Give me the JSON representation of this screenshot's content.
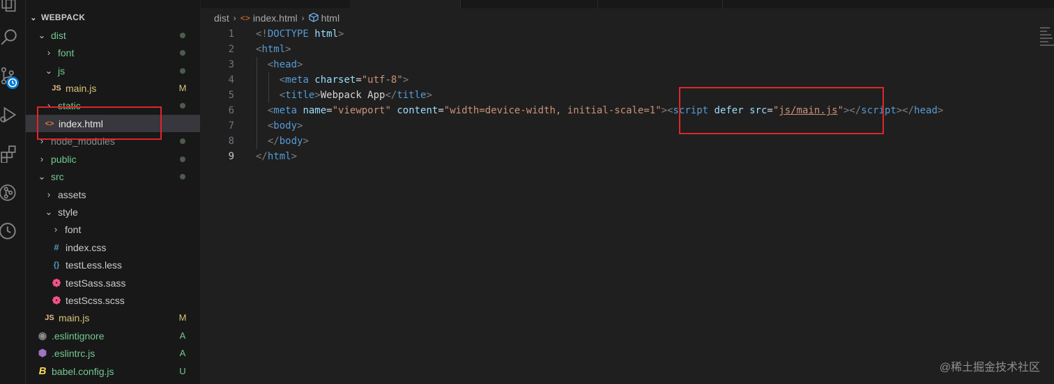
{
  "activity_bar": {
    "icons": [
      "explorer-icon",
      "search-icon",
      "source-control-icon",
      "run-debug-icon",
      "extensions-icon",
      "git-graph-icon",
      "timeline-icon"
    ]
  },
  "explorer": {
    "section_title": "WEBPACK",
    "items": [
      {
        "label": "dist",
        "status": "dot"
      },
      {
        "label": "font",
        "status": "dot"
      },
      {
        "label": "js",
        "status": "dot"
      },
      {
        "label": "main.js",
        "file_icon": "JS",
        "status": "M"
      },
      {
        "label": "static",
        "status": "dot"
      },
      {
        "label": "index.html",
        "file_icon": "<>",
        "status": ""
      },
      {
        "label": "node_modules",
        "status": "dot"
      },
      {
        "label": "public",
        "status": "dot"
      },
      {
        "label": "src",
        "status": "dot"
      },
      {
        "label": "assets",
        "status": ""
      },
      {
        "label": "style",
        "status": ""
      },
      {
        "label": "font",
        "status": ""
      },
      {
        "label": "index.css",
        "file_icon": "#",
        "status": ""
      },
      {
        "label": "testLess.less",
        "file_icon": "{}",
        "status": ""
      },
      {
        "label": "testSass.sass",
        "file_icon": "sass",
        "status": ""
      },
      {
        "label": "testScss.scss",
        "file_icon": "sass",
        "status": ""
      },
      {
        "label": "main.js",
        "file_icon": "JS",
        "status": "M"
      },
      {
        "label": ".eslintignore",
        "file_icon": "eslint",
        "status": "A"
      },
      {
        "label": ".eslintrc.js",
        "file_icon": "eslint",
        "status": "A"
      },
      {
        "label": "babel.config.js",
        "file_icon": "babel",
        "status": "U"
      }
    ]
  },
  "breadcrumb": {
    "folder": "dist",
    "file": "index.html",
    "symbol": "html"
  },
  "editor": {
    "line_numbers": [
      "1",
      "2",
      "3",
      "4",
      "5",
      "6",
      "7",
      "8",
      "9"
    ],
    "lines": {
      "l1_p1": "<!",
      "l1_doctype": "DOCTYPE",
      "l1_html": " html",
      "l1_p2": ">",
      "l2_p1": "<",
      "l2_tag": "html",
      "l2_p2": ">",
      "l3_p1": "<",
      "l3_tag": "head",
      "l3_p2": ">",
      "l4_p1": "<",
      "l4_tag": "meta",
      "l4_attr": " charset",
      "l4_eq": "=",
      "l4_str": "\"utf-8\"",
      "l4_p2": ">",
      "l5_p1": "<",
      "l5_tag": "title",
      "l5_p2": ">",
      "l5_txt": "Webpack App",
      "l5_p3": "</",
      "l5_tag2": "title",
      "l5_p4": ">",
      "l6_p1": "<",
      "l6_tag": "meta",
      "l6_attr1": " name",
      "l6_eq1": "=",
      "l6_str1": "\"viewport\"",
      "l6_attr2": " content",
      "l6_eq2": "=",
      "l6_str2": "\"width=device-width, initial-scale=1\"",
      "l6_p2": "><",
      "l6_tag2": "script",
      "l6_attr3": " defer",
      "l6_attr4": " src",
      "l6_eq3": "=",
      "l6_q1": "\"",
      "l6_link": "js/main.js",
      "l6_q2": "\"",
      "l6_p3": "></",
      "l6_tag3": "script",
      "l6_p4": "></",
      "l6_tag4": "head",
      "l6_p5": ">",
      "l7_p1": "<",
      "l7_tag": "body",
      "l7_p2": ">",
      "l8_p1": "</",
      "l8_tag": "body",
      "l8_p2": ">",
      "l9_p1": "</",
      "l9_tag": "html",
      "l9_p2": ">"
    }
  },
  "watermark": "@稀土掘金技术社区",
  "colors": {
    "highlight_box": "#e0252a",
    "selected_row": "#37373d",
    "editor_bg": "#1f1f1f"
  }
}
